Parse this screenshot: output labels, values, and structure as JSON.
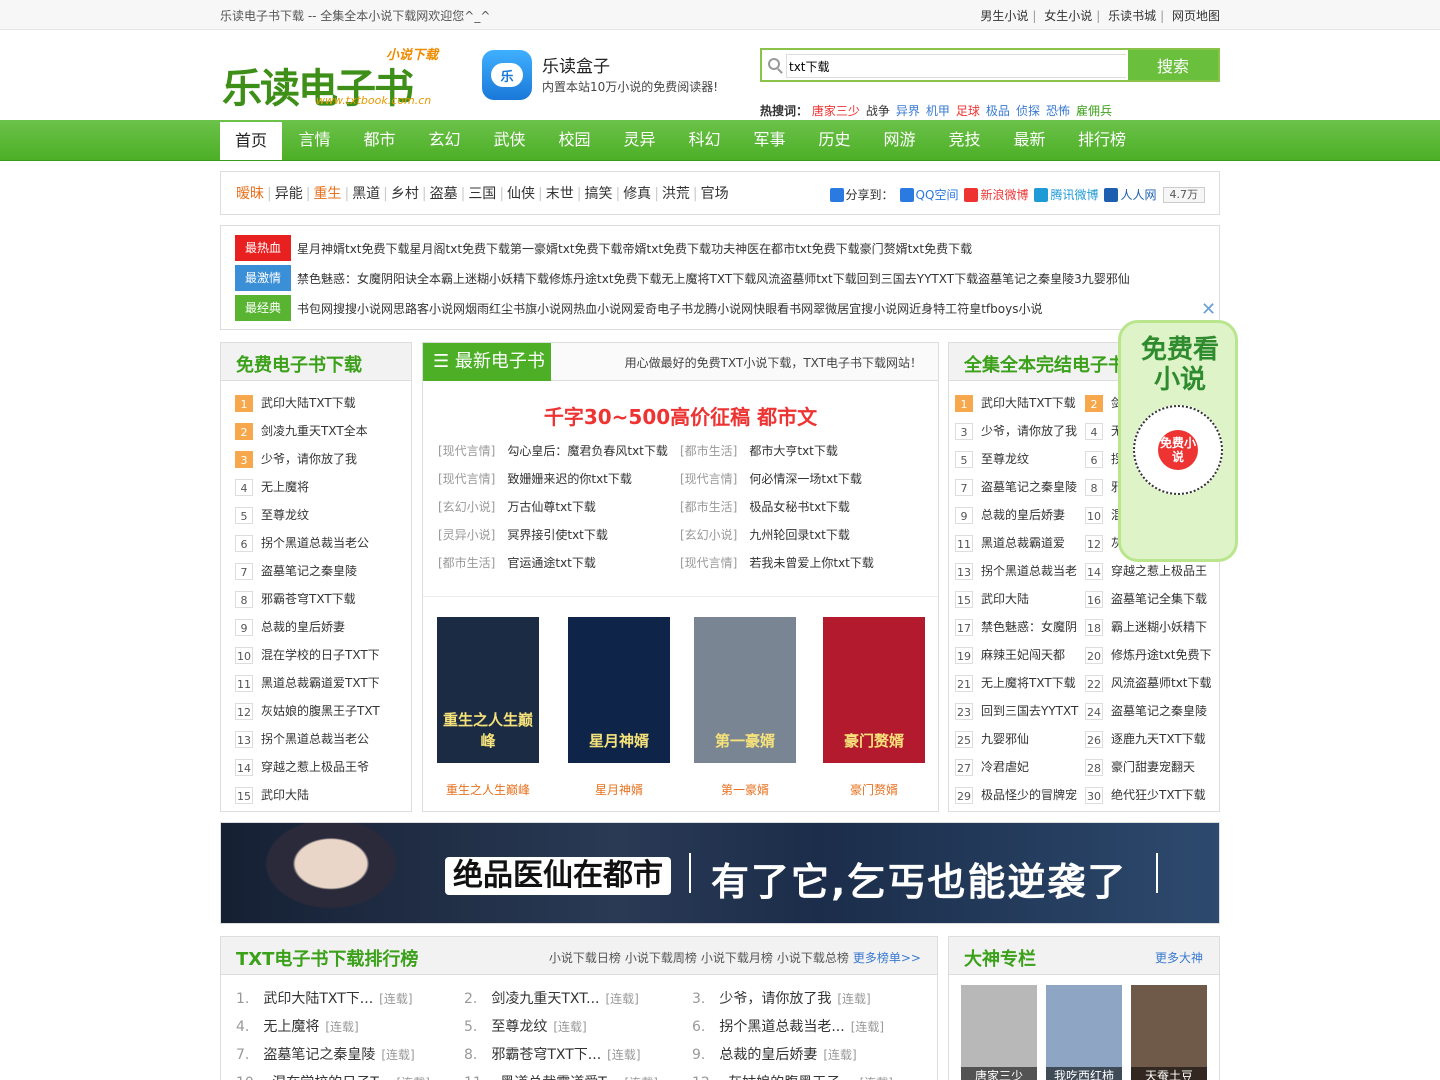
{
  "topbar": {
    "welcome": "乐读电子书下载 -- 全集全本小说下载网欢迎您^_^",
    "links": [
      "男生小说",
      "女生小说",
      "乐读书城",
      "网页地图"
    ]
  },
  "logo": {
    "main": "乐读电子书",
    "sub": "小说下载",
    "url": "www.txtbook.com.cn"
  },
  "app": {
    "icon": "乐",
    "name": "乐读盒子",
    "desc": "内置本站10万小说的免费阅读器!"
  },
  "search": {
    "value": "txt下载",
    "button": "搜索"
  },
  "hot": {
    "label": "热搜词：",
    "words": [
      {
        "t": "唐家三少",
        "c": "#e33"
      },
      {
        "t": "战争",
        "c": "#333"
      },
      {
        "t": "异界",
        "c": "#3a7ad0"
      },
      {
        "t": "机甲",
        "c": "#3a7ad0"
      },
      {
        "t": "足球",
        "c": "#e33"
      },
      {
        "t": "极品",
        "c": "#3a7ad0"
      },
      {
        "t": "侦探",
        "c": "#3a7ad0"
      },
      {
        "t": "恐怖",
        "c": "#3a7ad0"
      },
      {
        "t": "雇佣兵",
        "c": "#3ca11a"
      }
    ]
  },
  "nav": [
    "首页",
    "言情",
    "都市",
    "玄幻",
    "武侠",
    "校园",
    "灵异",
    "科幻",
    "军事",
    "历史",
    "网游",
    "竞技",
    "最新",
    "排行榜"
  ],
  "tags": [
    {
      "t": "暧昧",
      "hl": true
    },
    {
      "t": "异能"
    },
    {
      "t": "重生",
      "hl": true
    },
    {
      "t": "黑道"
    },
    {
      "t": "乡村"
    },
    {
      "t": "盗墓"
    },
    {
      "t": "三国"
    },
    {
      "t": "仙侠"
    },
    {
      "t": "末世"
    },
    {
      "t": "搞笑"
    },
    {
      "t": "修真"
    },
    {
      "t": "洪荒"
    },
    {
      "t": "官场"
    }
  ],
  "share": {
    "label": "分享到：",
    "items": [
      {
        "t": "QQ空间",
        "c": "#2a7ae2"
      },
      {
        "t": "新浪微博",
        "c": "#e33"
      },
      {
        "t": "腾讯微博",
        "c": "#1e9ad6"
      },
      {
        "t": "人人网",
        "c": "#1d5fae"
      }
    ],
    "count": "4.7万"
  },
  "recommend": [
    {
      "tag": "最热血",
      "color": "#e8201f",
      "items": [
        {
          "t": "星月神婿txt免费下载"
        },
        {
          "t": "星月阁txt免费下载"
        },
        {
          "t": "第一豪婿txt免费下载"
        },
        {
          "t": "帝婿txt免费下载"
        },
        {
          "t": "功夫神医在都市txt免费下载"
        },
        {
          "t": "豪门赘婿txt免费下载"
        }
      ]
    },
    {
      "tag": "最激情",
      "color": "#3a8fd6",
      "items": [
        {
          "t": "禁色魅惑：女魔阴阳诀全本"
        },
        {
          "t": "霸上迷糊小妖精下载"
        },
        {
          "t": "修炼丹途txt免费下载"
        },
        {
          "t": "无上魔将TXT下载"
        },
        {
          "t": "风流盗墓师txt下载"
        },
        {
          "t": "回到三国去YYTXT下载"
        },
        {
          "t": "盗墓笔记之秦皇陵3"
        },
        {
          "t": "九婴邪仙"
        }
      ]
    },
    {
      "tag": "最经典",
      "color": "#58b431",
      "items": [
        {
          "t": "书包网",
          "red": true
        },
        {
          "t": "搜搜小说网"
        },
        {
          "t": "思路客小说网"
        },
        {
          "t": "烟雨红尘",
          "red": true
        },
        {
          "t": "书旗小说网"
        },
        {
          "t": "热血小说网"
        },
        {
          "t": "爱奇电子书",
          "red": true
        },
        {
          "t": "龙腾小说网"
        },
        {
          "t": "快眼看书网"
        },
        {
          "t": "翠微居",
          "red": true
        },
        {
          "t": "宜搜小说网"
        },
        {
          "t": "近身特工"
        },
        {
          "t": "符皇"
        },
        {
          "t": "tfboys小说",
          "red": true
        }
      ]
    }
  ],
  "left_box": {
    "title": "免费电子书下载",
    "items": [
      "武印大陆TXT下载",
      "剑凌九重天TXT全本",
      "少爷，请你放了我",
      "无上魔将",
      "至尊龙纹",
      "拐个黑道总裁当老公",
      "盗墓笔记之秦皇陵",
      "邪霸苍穹TXT下载",
      "总裁的皇后娇妻",
      "混在学校的日子TXT下",
      "黑道总裁霸道爱TXT下",
      "灰姑娘的腹黑王子TXT",
      "拐个黑道总裁当老公",
      "穿越之惹上极品王爷",
      "武印大陆"
    ]
  },
  "mid_box": {
    "title": "最新电子书",
    "slogan": "用心做最好的免费TXT小说下载，TXT电子书下载网站！",
    "headline": "千字30~500高价征稿 都市文",
    "list": [
      {
        "cat": "[现代言情]",
        "t": "勾心皇后：魔君负春风txt下载"
      },
      {
        "cat": "[都市生活]",
        "t": "都市大亨txt下载"
      },
      {
        "cat": "[现代言情]",
        "t": "致姗姗来迟的你txt下载"
      },
      {
        "cat": "[现代言情]",
        "t": "何必情深一场txt下载"
      },
      {
        "cat": "[玄幻小说]",
        "t": "万古仙尊txt下载"
      },
      {
        "cat": "[都市生活]",
        "t": "极品女秘书txt下载"
      },
      {
        "cat": "[灵异小说]",
        "t": "冥界接引使txt下载"
      },
      {
        "cat": "[玄幻小说]",
        "t": "九州轮回录txt下载"
      },
      {
        "cat": "[都市生活]",
        "t": "官运通途txt下载"
      },
      {
        "cat": "[现代言情]",
        "t": "若我未曾爱上你txt下载"
      }
    ],
    "covers": [
      {
        "t": "重生之人生巅峰",
        "cover_text": "重生之人生巅峰",
        "bg": "#1c2b44"
      },
      {
        "t": "星月神婿",
        "cover_text": "星月神婿",
        "bg": "#0e2448"
      },
      {
        "t": "第一豪婿",
        "cover_text": "第一豪婿",
        "bg": "#7a8593"
      },
      {
        "t": "豪门赘婿",
        "cover_text": "豪门赘婿",
        "bg": "#b41a2e"
      }
    ]
  },
  "right_box": {
    "title": "全集全本完结电子书",
    "items": [
      "武印大陆TXT下载",
      "剑凌九重天TXT",
      "少爷，请你放了我",
      "无上魔将",
      "至尊龙纹",
      "拐个黑道总裁当老",
      "盗墓笔记之秦皇陵",
      "邪霸苍穹TXT下载",
      "总裁的皇后娇妻",
      "混在学校的日子",
      "黑道总裁霸道爱",
      "灰姑娘的腹黑王子",
      "拐个黑道总裁当老",
      "穿越之惹上极品王",
      "武印大陆",
      "盗墓笔记全集下载",
      "禁色魅惑：女魔阴",
      "霸上迷糊小妖精下",
      "麻辣王妃闯天都",
      "修炼丹途txt免费下",
      "无上魔将TXT下载",
      "风流盗墓师txt下载",
      "回到三国去YYTXT",
      "盗墓笔记之秦皇陵",
      "九婴邪仙",
      "逐鹿九天TXT下载",
      "冷君虐妃",
      "豪门甜妻宠翻天",
      "极品怪少的冒牌宠",
      "绝代狂少TXT下载"
    ]
  },
  "banner": {
    "left": "绝品医仙在都市",
    "right": "有了它,乞丐也能逆袭了"
  },
  "ranking": {
    "title": "TXT电子书下载排行榜",
    "links": [
      "小说下载日榜",
      "小说下载周榜",
      "小说下载月榜",
      "小说下载总榜"
    ],
    "more": "更多榜单>>",
    "status": "[连载]",
    "items": [
      "武印大陆TXT下...",
      "剑凌九重天TXT...",
      "少爷，请你放了我",
      "无上魔将",
      "至尊龙纹",
      "拐个黑道总裁当老...",
      "盗墓笔记之秦皇陵",
      "邪霸苍穹TXT下...",
      "总裁的皇后娇妻",
      "混在学校的日子T...",
      "黑道总裁霸道爱T...",
      "灰姑娘的腹黑王子..."
    ]
  },
  "authors": {
    "title": "大神专栏",
    "more": "更多大神",
    "items": [
      "唐家三少",
      "我吃西红柿",
      "天蚕土豆"
    ]
  },
  "qr_ad": {
    "title": "免费看小说",
    "badge": "免费小说"
  }
}
